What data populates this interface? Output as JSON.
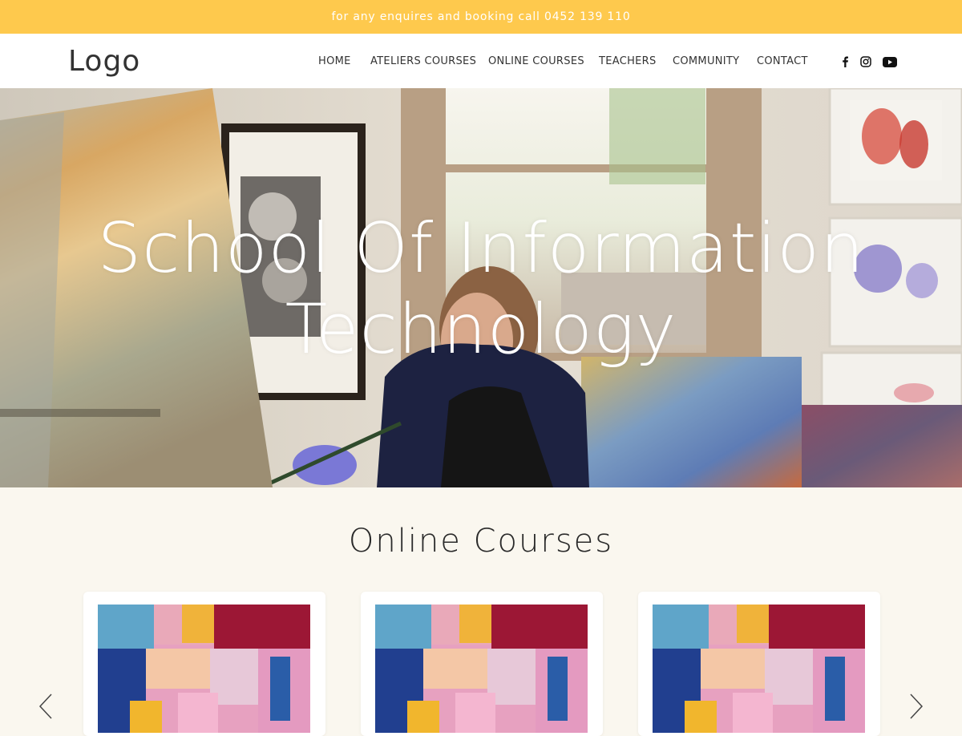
{
  "topbar": {
    "text": "for any enquires and booking call 0452 139 110"
  },
  "header": {
    "logo": "Logo",
    "nav": [
      {
        "label": "HOME"
      },
      {
        "label": "ATELIERS COURSES"
      },
      {
        "label": "ONLINE COURSES"
      },
      {
        "label": "TEACHERS"
      },
      {
        "label": "COMMUNITY"
      },
      {
        "label": "CONTACT"
      }
    ],
    "social": [
      "facebook-icon",
      "instagram-icon",
      "youtube-icon"
    ]
  },
  "hero": {
    "title_line1": "School Of Information",
    "title_line2": "Technology"
  },
  "courses": {
    "heading": "Online Courses",
    "cards": [
      {
        "image": "abstract-painting"
      },
      {
        "image": "abstract-painting"
      },
      {
        "image": "abstract-painting"
      }
    ],
    "prev_icon": "chevron-left-icon",
    "next_icon": "chevron-right-icon"
  },
  "colors": {
    "topbar": "#fec94d",
    "header_bg": "#ffffff",
    "section_bg": "#faf7ef",
    "text": "#333333"
  }
}
